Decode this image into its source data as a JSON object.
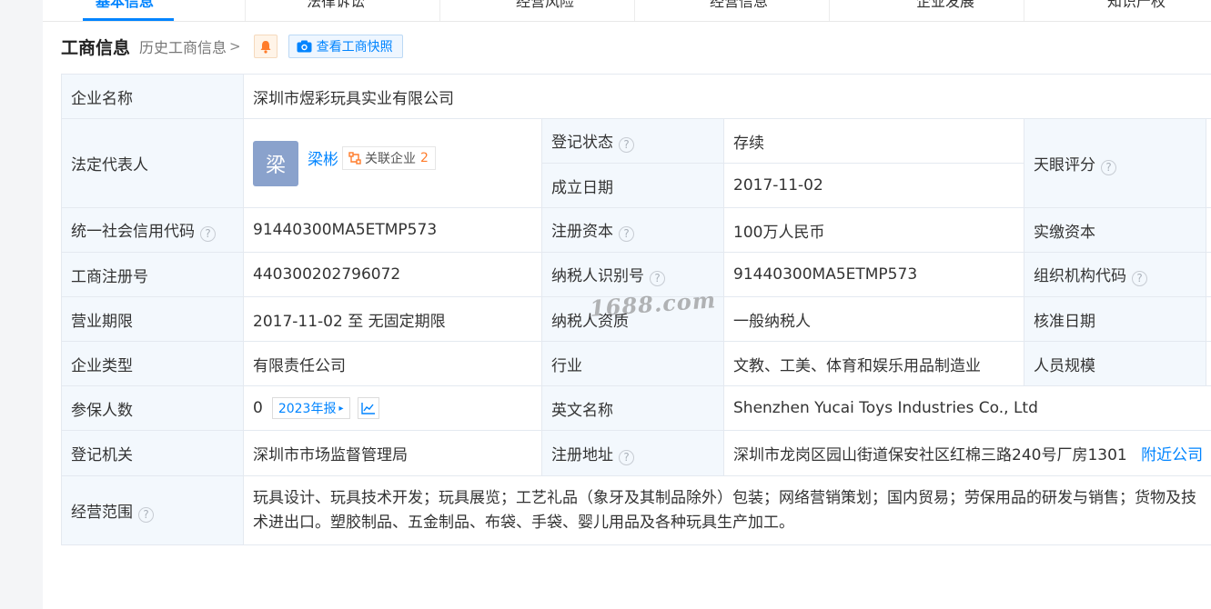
{
  "tabs": [
    {
      "label": "基本信息",
      "active": true
    },
    {
      "label": "法律诉讼",
      "active": false
    },
    {
      "label": "经营风险",
      "active": false
    },
    {
      "label": "经营信息",
      "active": false
    },
    {
      "label": "企业发展",
      "active": false
    },
    {
      "label": "知识产权",
      "active": false
    }
  ],
  "section": {
    "title": "工商信息",
    "history_link": "历史工商信息",
    "snapshot_label": "查看工商快照"
  },
  "table": {
    "company_name_label": "企业名称",
    "company_name": "深圳市煜彩玩具实业有限公司",
    "legal_rep_label": "法定代表人",
    "legal_rep_avatar": "梁",
    "legal_rep_name": "梁彬",
    "related_label": "关联企业",
    "related_count": "2",
    "reg_status_label": "登记状态",
    "reg_status": "存续",
    "est_date_label": "成立日期",
    "est_date": "2017-11-02",
    "tianyan_label": "天眼评分",
    "credit_code_label": "统一社会信用代码",
    "credit_code": "91440300MA5ETMP573",
    "reg_capital_label": "注册资本",
    "reg_capital": "100万人民币",
    "paid_capital_label": "实缴资本",
    "biz_reg_no_label": "工商注册号",
    "biz_reg_no": "440300202796072",
    "taxpayer_id_label": "纳税人识别号",
    "taxpayer_id": "91440300MA5ETMP573",
    "org_code_label": "组织机构代码",
    "biz_term_label": "营业期限",
    "biz_term": "2017-11-02 至 无固定期限",
    "taxpayer_qual_label": "纳税人资质",
    "taxpayer_qual": "一般纳税人",
    "approval_date_label": "核准日期",
    "company_type_label": "企业类型",
    "company_type": "有限责任公司",
    "industry_label": "行业",
    "industry": "文教、工美、体育和娱乐用品制造业",
    "staff_size_label": "人员规模",
    "insured_label": "参保人数",
    "insured_count": "0",
    "annual_report": "2023年报",
    "english_name_label": "英文名称",
    "english_name": "Shenzhen Yucai Toys Industries Co., Ltd",
    "reg_authority_label": "登记机关",
    "reg_authority": "深圳市市场监督管理局",
    "reg_address_label": "注册地址",
    "reg_address": "深圳市龙岗区园山街道保安社区红棉三路240号厂房1301",
    "nearby_link": "附近公司",
    "scope_label": "经营范围",
    "scope": "玩具设计、玩具技术开发；玩具展览；工艺礼品（象牙及其制品除外）包装；网络营销策划；国内贸易；劳保用品的研发与销售；货物及技术进出口。塑胶制品、五金制品、布袋、手袋、婴儿用品及各种玩具生产加工。"
  },
  "watermark": "1688.com",
  "colors": {
    "accent": "#0084ff",
    "label_bg": "#f3f8fd",
    "status_green": "#2a9c3c",
    "count_orange": "#ff7c2b"
  }
}
